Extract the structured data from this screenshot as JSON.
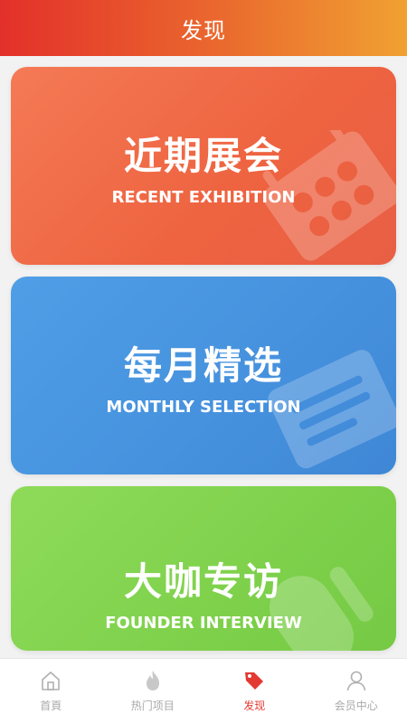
{
  "header": {
    "title": "发现"
  },
  "cards": [
    {
      "title_cn": "近期展会",
      "title_en": "RECENT EXHIBITION",
      "icon": "ticket-icon"
    },
    {
      "title_cn": "每月精选",
      "title_en": "MONTHLY SELECTION",
      "icon": "card-icon"
    },
    {
      "title_cn": "大咖专访",
      "title_en": "FOUNDER INTERVIEW",
      "icon": "microphone-icon"
    }
  ],
  "tabbar": {
    "items": [
      {
        "label": "首頁",
        "icon": "home-icon",
        "active": false
      },
      {
        "label": "热门项目",
        "icon": "fire-icon",
        "active": false
      },
      {
        "label": "发现",
        "icon": "tag-icon",
        "active": true
      },
      {
        "label": "会员中心",
        "icon": "user-icon",
        "active": false
      }
    ]
  },
  "colors": {
    "accent": "#e23a32",
    "inactive": "#a9a9a9"
  }
}
